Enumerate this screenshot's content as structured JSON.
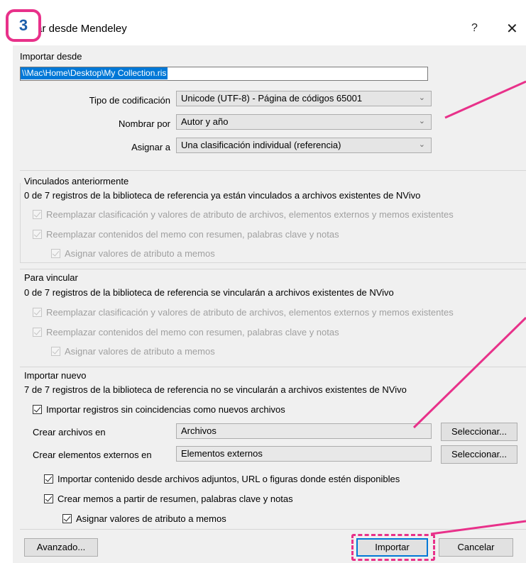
{
  "badge": "3",
  "window": {
    "title": "Importar desde Mendeley",
    "title_visible": "tar desde Mendeley",
    "help": "?",
    "close": "✕"
  },
  "import_from": {
    "label": "Importar desde",
    "path": "\\\\Mac\\Home\\Desktop\\My Collection.ris",
    "encoding_label": "Tipo de codificación",
    "encoding_value": "Unicode (UTF-8) - Página de códigos 65001",
    "name_by_label": "Nombrar por",
    "name_by_value": "Autor y año",
    "assign_label": "Asignar a",
    "assign_value": "Una clasificación individual (referencia)"
  },
  "previously_linked": {
    "heading": "Vinculados anteriormente",
    "summary": "0 de 7 registros de la biblioteca de referencia ya están vinculados a archivos existentes de NVivo",
    "opt1": "Reemplazar clasificación y valores de atributo de archivos, elementos externos y memos existentes",
    "opt2": "Reemplazar contenidos del memo con resumen, palabras clave y notas",
    "opt3": "Asignar valores de atributo a memos"
  },
  "to_link": {
    "heading": "Para vincular",
    "summary": "0 de 7 registros de la biblioteca de referencia se vincularán a archivos existentes de NVivo",
    "opt1": "Reemplazar clasificación y valores de atributo de archivos, elementos externos y memos existentes",
    "opt2": "Reemplazar contenidos del memo con resumen, palabras clave y notas",
    "opt3": "Asignar valores de atributo a memos"
  },
  "import_new": {
    "heading": "Importar nuevo",
    "summary": "7 de 7 registros de la biblioteca de referencia no se vincularán a archivos existentes de NVivo",
    "import_unmatched": "Importar registros sin coincidencias como nuevos archivos",
    "create_files_label": "Crear archivos en",
    "create_files_value": "Archivos",
    "create_externals_label": "Crear elementos externos en",
    "create_externals_value": "Elementos externos",
    "select_button": "Seleccionar...",
    "import_content": "Importar contenido desde archivos adjuntos, URL o figuras donde estén disponibles",
    "create_memos": "Crear memos a partir de resumen, palabras clave y notas",
    "assign_attrs": "Asignar valores de atributo a memos"
  },
  "buttons": {
    "advanced": "Avanzado...",
    "import": "Importar",
    "cancel": "Cancelar"
  },
  "colors": {
    "accent": "#e8318a",
    "badge_text": "#1b5eaa",
    "selection": "#0078d7"
  }
}
